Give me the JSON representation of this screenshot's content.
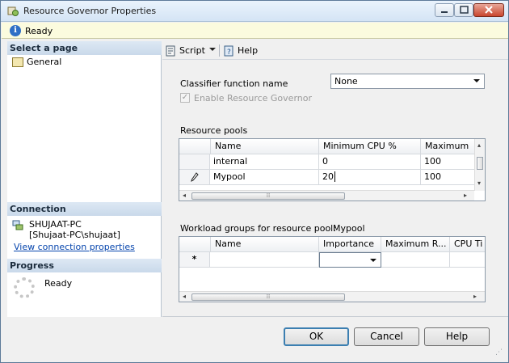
{
  "window": {
    "title": "Resource Governor Properties"
  },
  "status": {
    "text": "Ready"
  },
  "left_pane": {
    "select_page_header": "Select a page",
    "pages": [
      {
        "label": "General",
        "icon": "general-page-icon"
      }
    ],
    "connection_header": "Connection",
    "connection_server": "SHUJAAT-PC",
    "connection_user": "[Shujaat-PC\\shujaat]",
    "connection_link": "View connection properties",
    "progress_header": "Progress",
    "progress_text": "Ready"
  },
  "toolbar": {
    "script_label": "Script",
    "help_label": "Help"
  },
  "classifier": {
    "label": "Classifier function name",
    "value": "None",
    "enable_label": "Enable Resource Governor",
    "enable_checked": true,
    "enable_disabled": true
  },
  "resource_pools": {
    "label": "Resource pools",
    "columns": [
      "Name",
      "Minimum CPU %",
      "Maximum"
    ],
    "rows": [
      {
        "indicator": "",
        "cells": [
          "internal",
          "0",
          "100"
        ]
      },
      {
        "indicator": "pencil",
        "cells": [
          "Mypool",
          "20",
          "100"
        ]
      }
    ]
  },
  "workload_groups": {
    "label": "Workload groups for resource pool:",
    "pool_name": "Mypool",
    "columns": [
      "Name",
      "Importance",
      "Maximum R...",
      "CPU Ti"
    ],
    "new_row_indicator": "*"
  },
  "footer": {
    "ok_label": "OK",
    "cancel_label": "Cancel",
    "help_label": "Help"
  },
  "colors": {
    "status_bar": "#fbfbde",
    "section_header": "#c9d9ea",
    "link": "#0645ad",
    "ok_border": "#3c7fb1"
  }
}
